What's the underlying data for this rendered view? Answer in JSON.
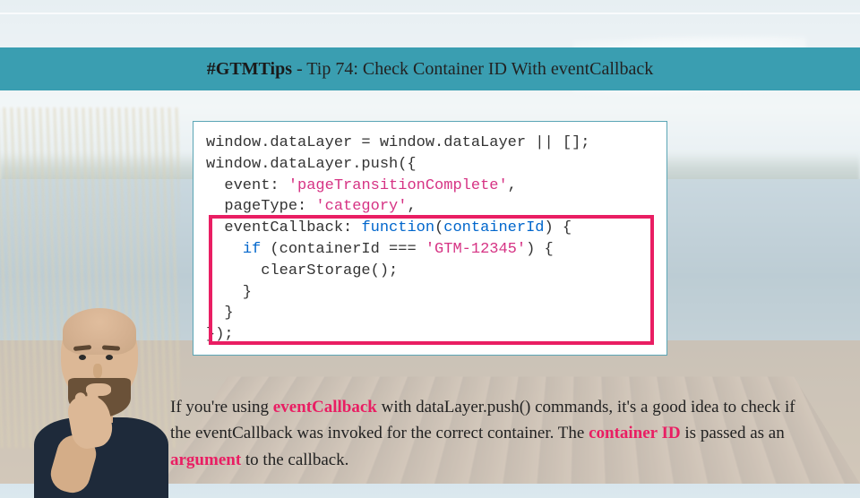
{
  "header": {
    "hashtag": "#GTMTips",
    "separator": " - ",
    "title": "Tip 74: Check Container ID With eventCallback"
  },
  "code": {
    "line1": "window.dataLayer = window.dataLayer || [];",
    "line2": "window.dataLayer.push({",
    "line3_key": "  event: ",
    "line3_val": "'pageTransitionComplete'",
    "line3_end": ",",
    "line4_key": "  pageType: ",
    "line4_val": "'category'",
    "line4_end": ",",
    "line5_key": "  eventCallback: ",
    "line5_fn": "function",
    "line5_open": "(",
    "line5_param": "containerId",
    "line5_close": ") {",
    "line6_a": "    ",
    "line6_if": "if",
    "line6_b": " (containerId === ",
    "line6_val": "'GTM-12345'",
    "line6_c": ") {",
    "line7": "      clearStorage();",
    "line8": "    }",
    "line9": "  }",
    "line10": "});"
  },
  "description": {
    "t1": "If you're using ",
    "em1": "eventCallback",
    "t2": " with dataLayer.push() commands, it's a good idea to check if the eventCallback was invoked for the correct container. The ",
    "em2": "container ID",
    "t3": " is passed as an ",
    "em3": "argument",
    "t4": " to the callback."
  }
}
